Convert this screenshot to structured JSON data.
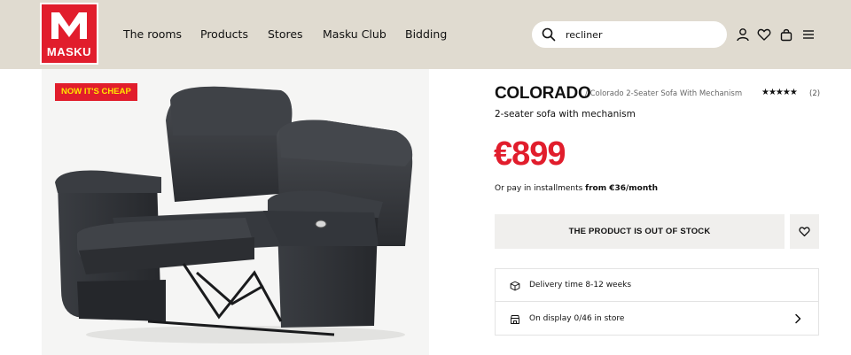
{
  "brand": {
    "name": "MASKU",
    "color": "#e11d2c"
  },
  "nav": {
    "items": [
      "The rooms",
      "Products",
      "Stores",
      "Masku Club",
      "Bidding"
    ]
  },
  "search": {
    "value": "recliner",
    "icon": "search-icon"
  },
  "header_icons": [
    "user-icon",
    "heart-icon",
    "bag-icon",
    "menu-icon"
  ],
  "badge": {
    "label": "NOW IT'S CHEAP",
    "bg": "#e11d2c",
    "fg": "#ffe500"
  },
  "product": {
    "name": "COLORADO",
    "breadcrumb": "/ Colorado 2-Seater Sofa With Mechanism",
    "rating_stars": "★★★★★",
    "rating": 4.5,
    "review_count": "(2)",
    "subtitle": "2-seater sofa with mechanism",
    "price": "€899",
    "installment_prefix": "Or pay in installments",
    "installment_amount": "from €36/month"
  },
  "actions": {
    "out_of_stock_label": "THE PRODUCT IS OUT OF STOCK"
  },
  "info": {
    "delivery": "Delivery time 8-12 weeks",
    "display": "On display 0/46 in store"
  }
}
